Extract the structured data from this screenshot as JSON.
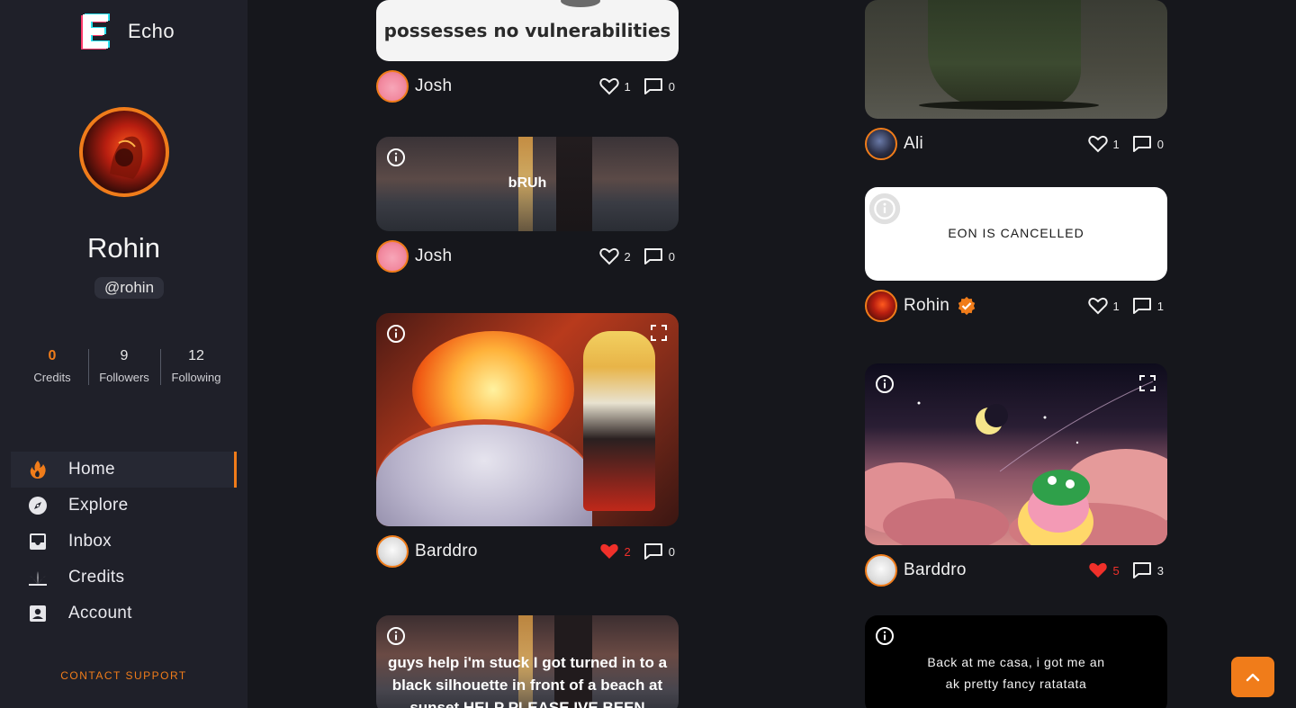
{
  "app": {
    "name": "Echo"
  },
  "profile": {
    "name": "Rohin",
    "handle": "@rohin"
  },
  "stats": [
    {
      "value": "0",
      "label": "Credits"
    },
    {
      "value": "9",
      "label": "Followers"
    },
    {
      "value": "12",
      "label": "Following"
    }
  ],
  "nav": [
    {
      "label": "Home",
      "icon": "fire-icon",
      "active": true
    },
    {
      "label": "Explore",
      "icon": "compass-icon"
    },
    {
      "label": "Inbox",
      "icon": "inbox-icon"
    },
    {
      "label": "Credits",
      "icon": "plant-icon"
    },
    {
      "label": "Account",
      "icon": "account-icon"
    }
  ],
  "support": "CONTACT SUPPORT",
  "colors": {
    "accent": "#f07c1a",
    "liked": "#f0302a",
    "sidebar": "#1f2029",
    "background": "#16171c"
  },
  "posts": [
    {
      "id": "p1",
      "caption": "possesses no vulnerabilities",
      "author": "Josh",
      "likes": "1",
      "comments": "0",
      "liked": false
    },
    {
      "id": "p2",
      "caption": "bRUh",
      "author": "Josh",
      "likes": "2",
      "comments": "0",
      "liked": false
    },
    {
      "id": "p3",
      "caption": "",
      "author": "Barddro",
      "likes": "2",
      "comments": "0",
      "liked": true
    },
    {
      "id": "p4",
      "caption": "guys help i'm stuck I got turned in to a black silhouette in front of a beach at sunset HELP PLEASE IVE BEEN STUCK"
    },
    {
      "id": "p5",
      "caption": "",
      "author": "Ali",
      "likes": "1",
      "comments": "0",
      "liked": false
    },
    {
      "id": "p6",
      "caption": "EON IS CANCELLED",
      "author": "Rohin",
      "verified": true,
      "likes": "1",
      "comments": "1",
      "liked": false
    },
    {
      "id": "p7",
      "caption": "",
      "author": "Barddro",
      "likes": "5",
      "comments": "3",
      "liked": true
    },
    {
      "id": "p8",
      "caption": "Back at me casa, i got me an ak pretty fancy ratatata"
    }
  ]
}
